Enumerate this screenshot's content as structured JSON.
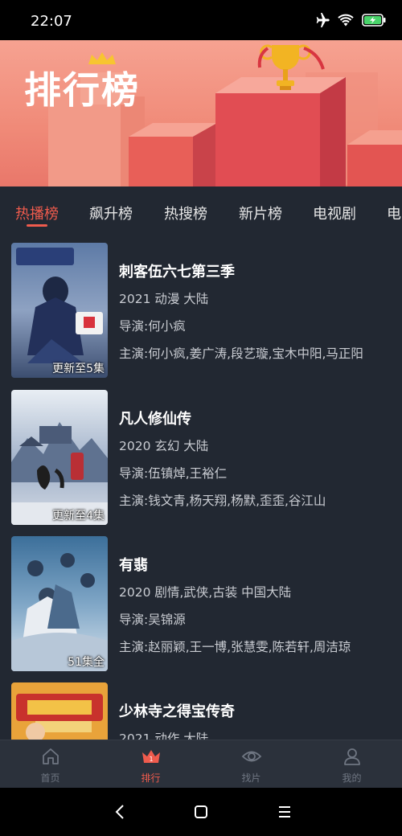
{
  "status": {
    "time": "22:07"
  },
  "banner": {
    "title": "排行榜"
  },
  "tabs": [
    {
      "label": "热播榜",
      "active": true
    },
    {
      "label": "飙升榜",
      "active": false
    },
    {
      "label": "热搜榜",
      "active": false
    },
    {
      "label": "新片榜",
      "active": false
    },
    {
      "label": "电视剧",
      "active": false
    },
    {
      "label": "电",
      "active": false
    }
  ],
  "items": [
    {
      "title": "刺客伍六七第三季",
      "info": "2021 动漫 大陆",
      "director": "导演:何小疯",
      "cast": "主演:何小疯,姜广涛,段艺璇,宝木中阳,马正阳",
      "badge": "更新至5集"
    },
    {
      "title": "凡人修仙传",
      "info": "2020 玄幻 大陆",
      "director": "导演:伍镇焯,王裕仁",
      "cast": "主演:钱文青,杨天翔,杨默,歪歪,谷江山",
      "badge": "更新至4集"
    },
    {
      "title": "有翡",
      "info": "2020 剧情,武侠,古装 中国大陆",
      "director": "导演:吴锦源",
      "cast": "主演:赵丽颖,王一博,张慧雯,陈若轩,周洁琼",
      "badge": "51集全"
    },
    {
      "title": "少林寺之得宝传奇",
      "info": "2021 动作 大陆",
      "director": "",
      "cast": "",
      "badge": ""
    }
  ],
  "bottom_nav": [
    {
      "label": "首页",
      "icon": "home-icon",
      "active": false
    },
    {
      "label": "排行",
      "icon": "crown-icon",
      "active": true
    },
    {
      "label": "找片",
      "icon": "eye-icon",
      "active": false
    },
    {
      "label": "我的",
      "icon": "user-icon",
      "active": false
    }
  ],
  "colors": {
    "accent": "#ef5b4d",
    "background": "#222832",
    "nav_background": "#2b313b"
  }
}
